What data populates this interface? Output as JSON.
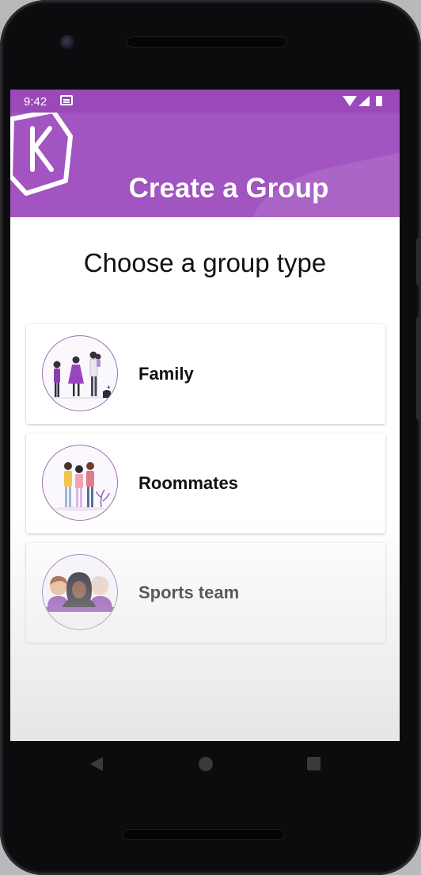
{
  "status_bar": {
    "time": "9:42",
    "icons": [
      "notification-icon",
      "wifi-icon",
      "signal-icon",
      "battery-icon"
    ]
  },
  "header": {
    "logo_letter": "K",
    "title": "Create a Group",
    "background_color": "#a254c1"
  },
  "main": {
    "subtitle": "Choose a group type",
    "group_types": [
      {
        "label": "Family",
        "illustration": "family-illustration"
      },
      {
        "label": "Roommates",
        "illustration": "roommates-illustration"
      },
      {
        "label": "Sports team",
        "illustration": "sports-team-illustration"
      }
    ]
  },
  "nav_bar": {
    "icons": [
      "back-icon",
      "home-icon",
      "recent-apps-icon"
    ]
  }
}
